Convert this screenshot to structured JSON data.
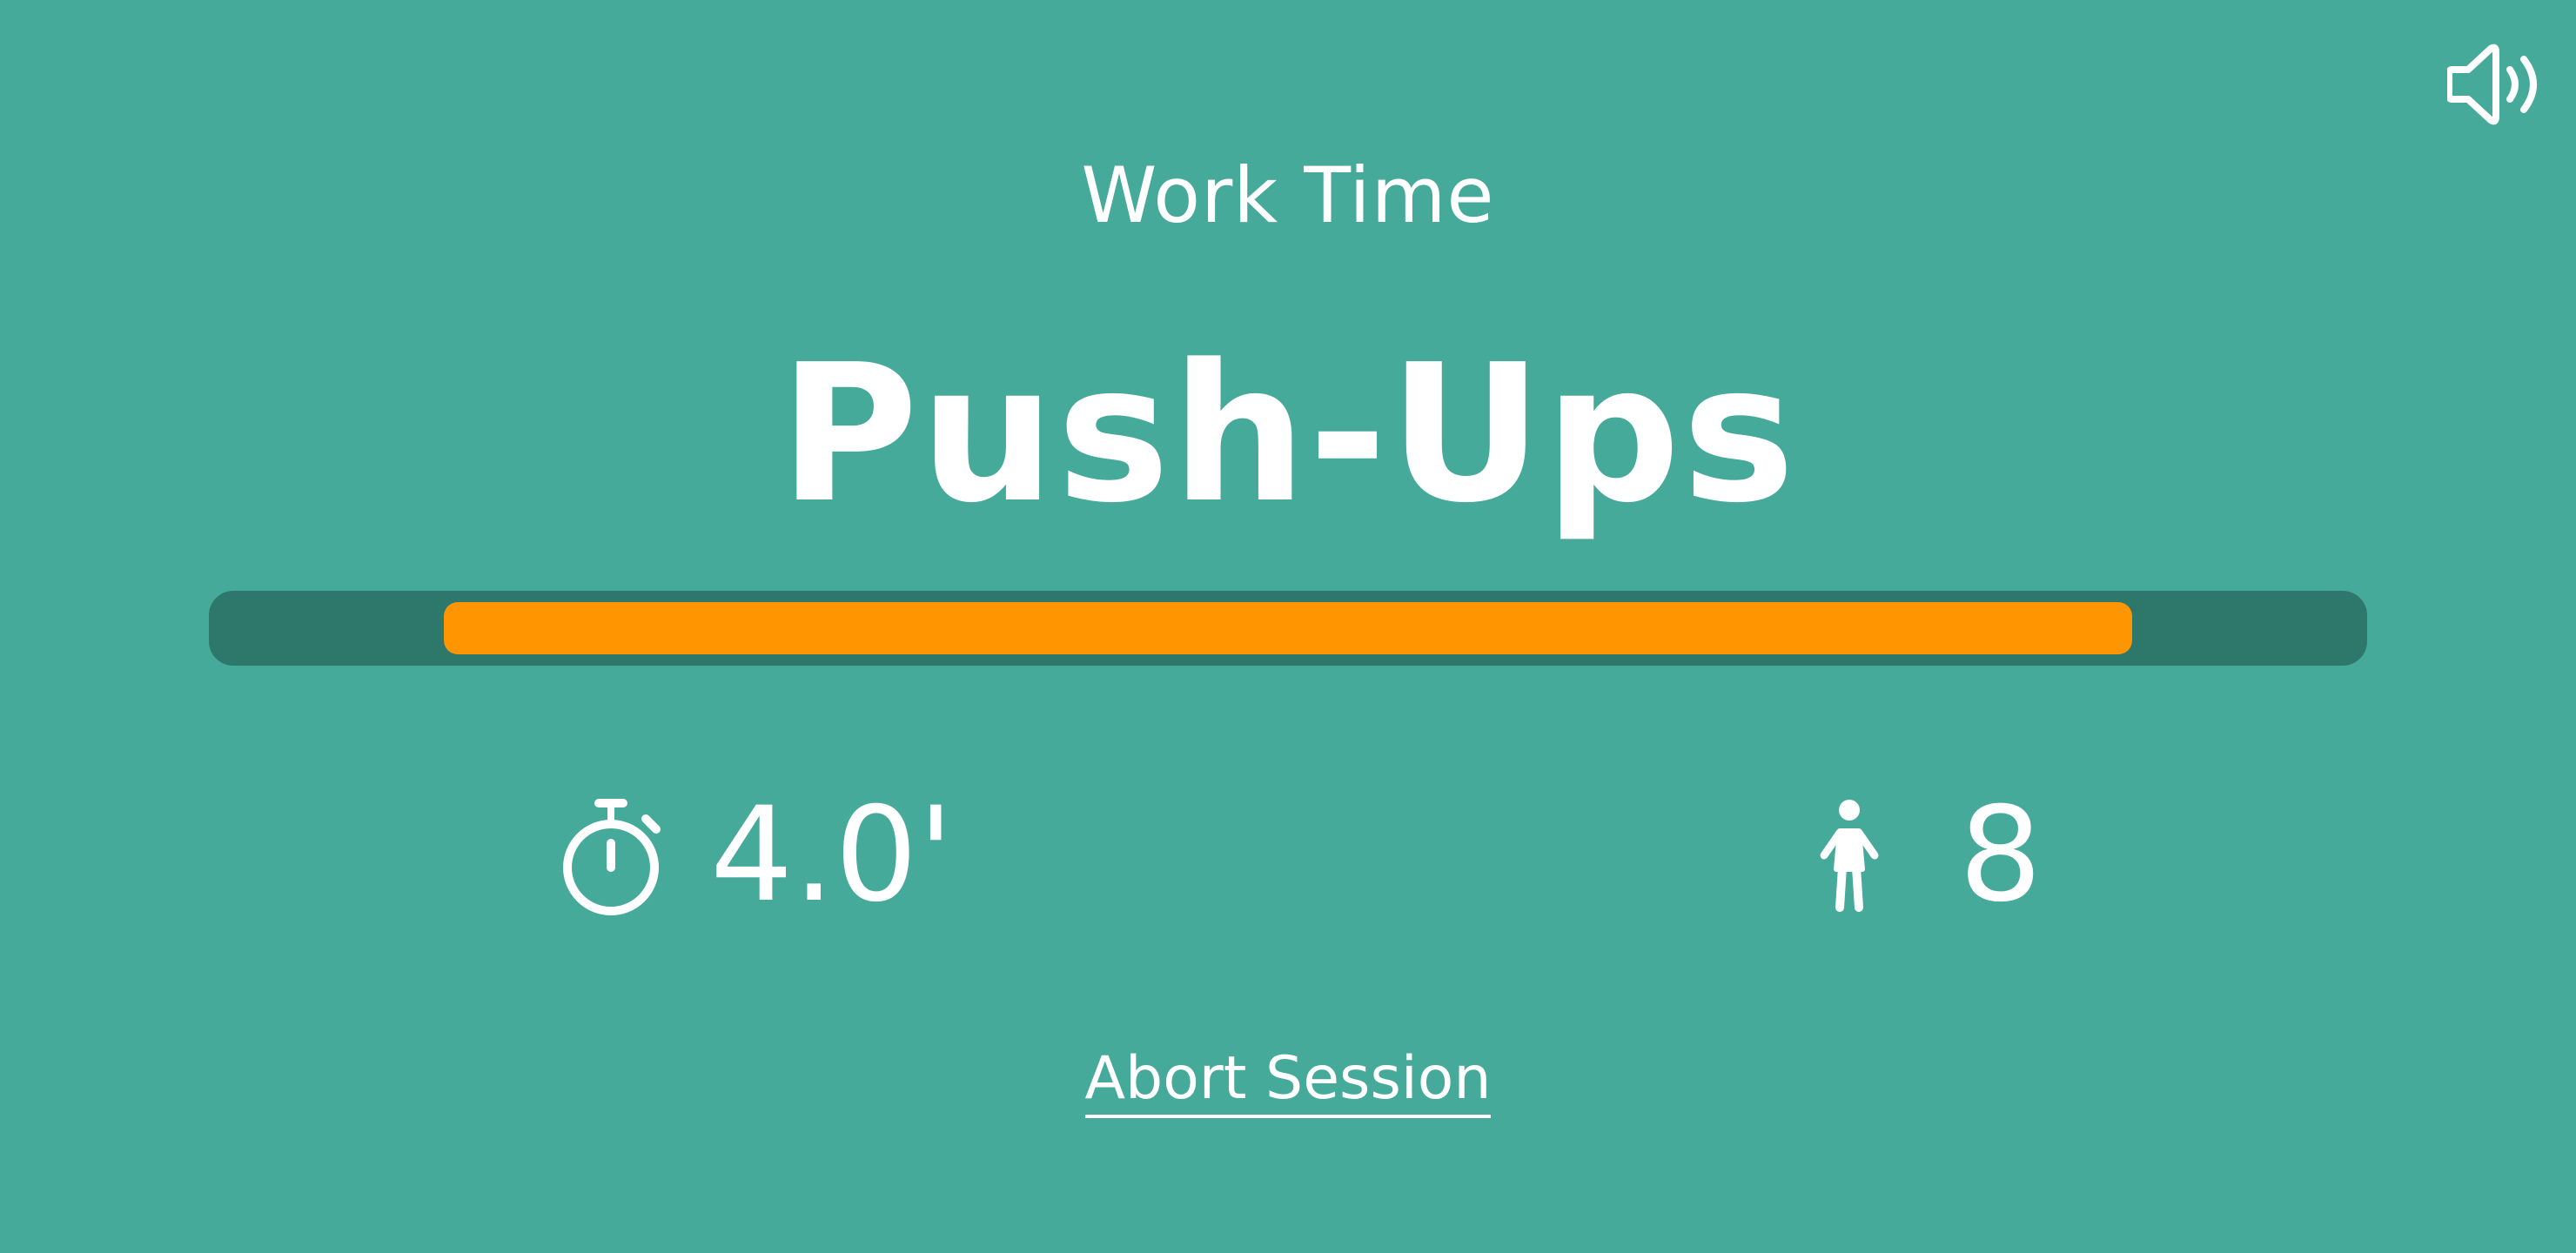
{
  "header": {
    "sound_icon": "speaker-volume-icon"
  },
  "workout": {
    "phase_label": "Work Time",
    "exercise_name": "Push-Ups",
    "progress": {
      "start_fraction": 0.109,
      "end_fraction": 0.891,
      "fill_color": "#ff9500",
      "track_color": "#2e776b"
    },
    "duration": {
      "icon": "stopwatch-icon",
      "value": "4.0'"
    },
    "reps": {
      "icon": "person-icon",
      "value": "8"
    }
  },
  "actions": {
    "abort_label": "Abort Session"
  },
  "colors": {
    "background": "#46aa9a",
    "text": "#ffffff"
  }
}
